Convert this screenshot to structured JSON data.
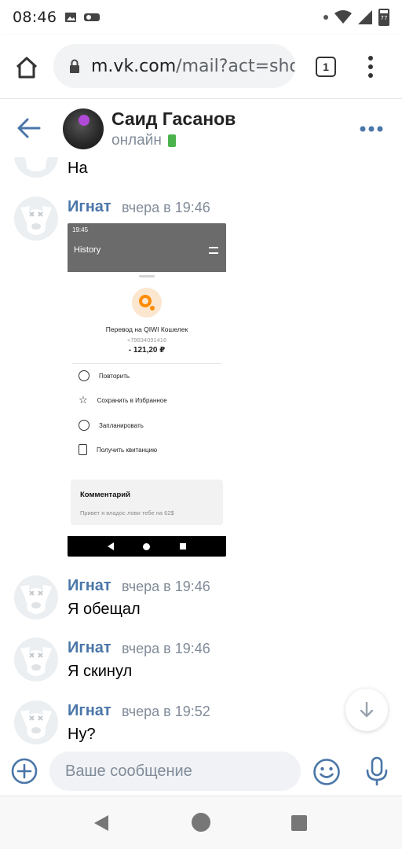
{
  "status_bar": {
    "time": "08:46",
    "battery": "77"
  },
  "browser": {
    "url_host": "m.vk.com",
    "url_rest": "/mail?act=sho",
    "tab_count": "1"
  },
  "chat": {
    "contact_name": "Саид Гасанов",
    "contact_status": "онлайн"
  },
  "messages": [
    {
      "author": "",
      "time": "",
      "text": "На"
    },
    {
      "author": "Игнат",
      "time": "вчера в 19:46",
      "attachment": {
        "status_time": "19:45",
        "screen_title": "History",
        "transfer_title": "Перевод на QIWI Кошелек",
        "phone": "+79834091416",
        "amount": "- 121,20 ₽",
        "actions": [
          "Повторить",
          "Сохранить в Избранное",
          "Запланировать",
          "Получить квитанцию"
        ],
        "comment_title": "Комментарий",
        "comment_text": "Привет я владос лови тебе на 62$"
      }
    },
    {
      "author": "Игнат",
      "time": "вчера в 19:46",
      "text": "Я обещал"
    },
    {
      "author": "Игнат",
      "time": "вчера в 19:46",
      "text": "Я скинул"
    },
    {
      "author": "Игнат",
      "time": "вчера в 19:52",
      "text": "Ну?"
    }
  ],
  "composer": {
    "placeholder": "Ваше сообщение"
  },
  "colors": {
    "accent": "#4a76a8",
    "online": "#4bb34b",
    "muted": "#818c99"
  }
}
